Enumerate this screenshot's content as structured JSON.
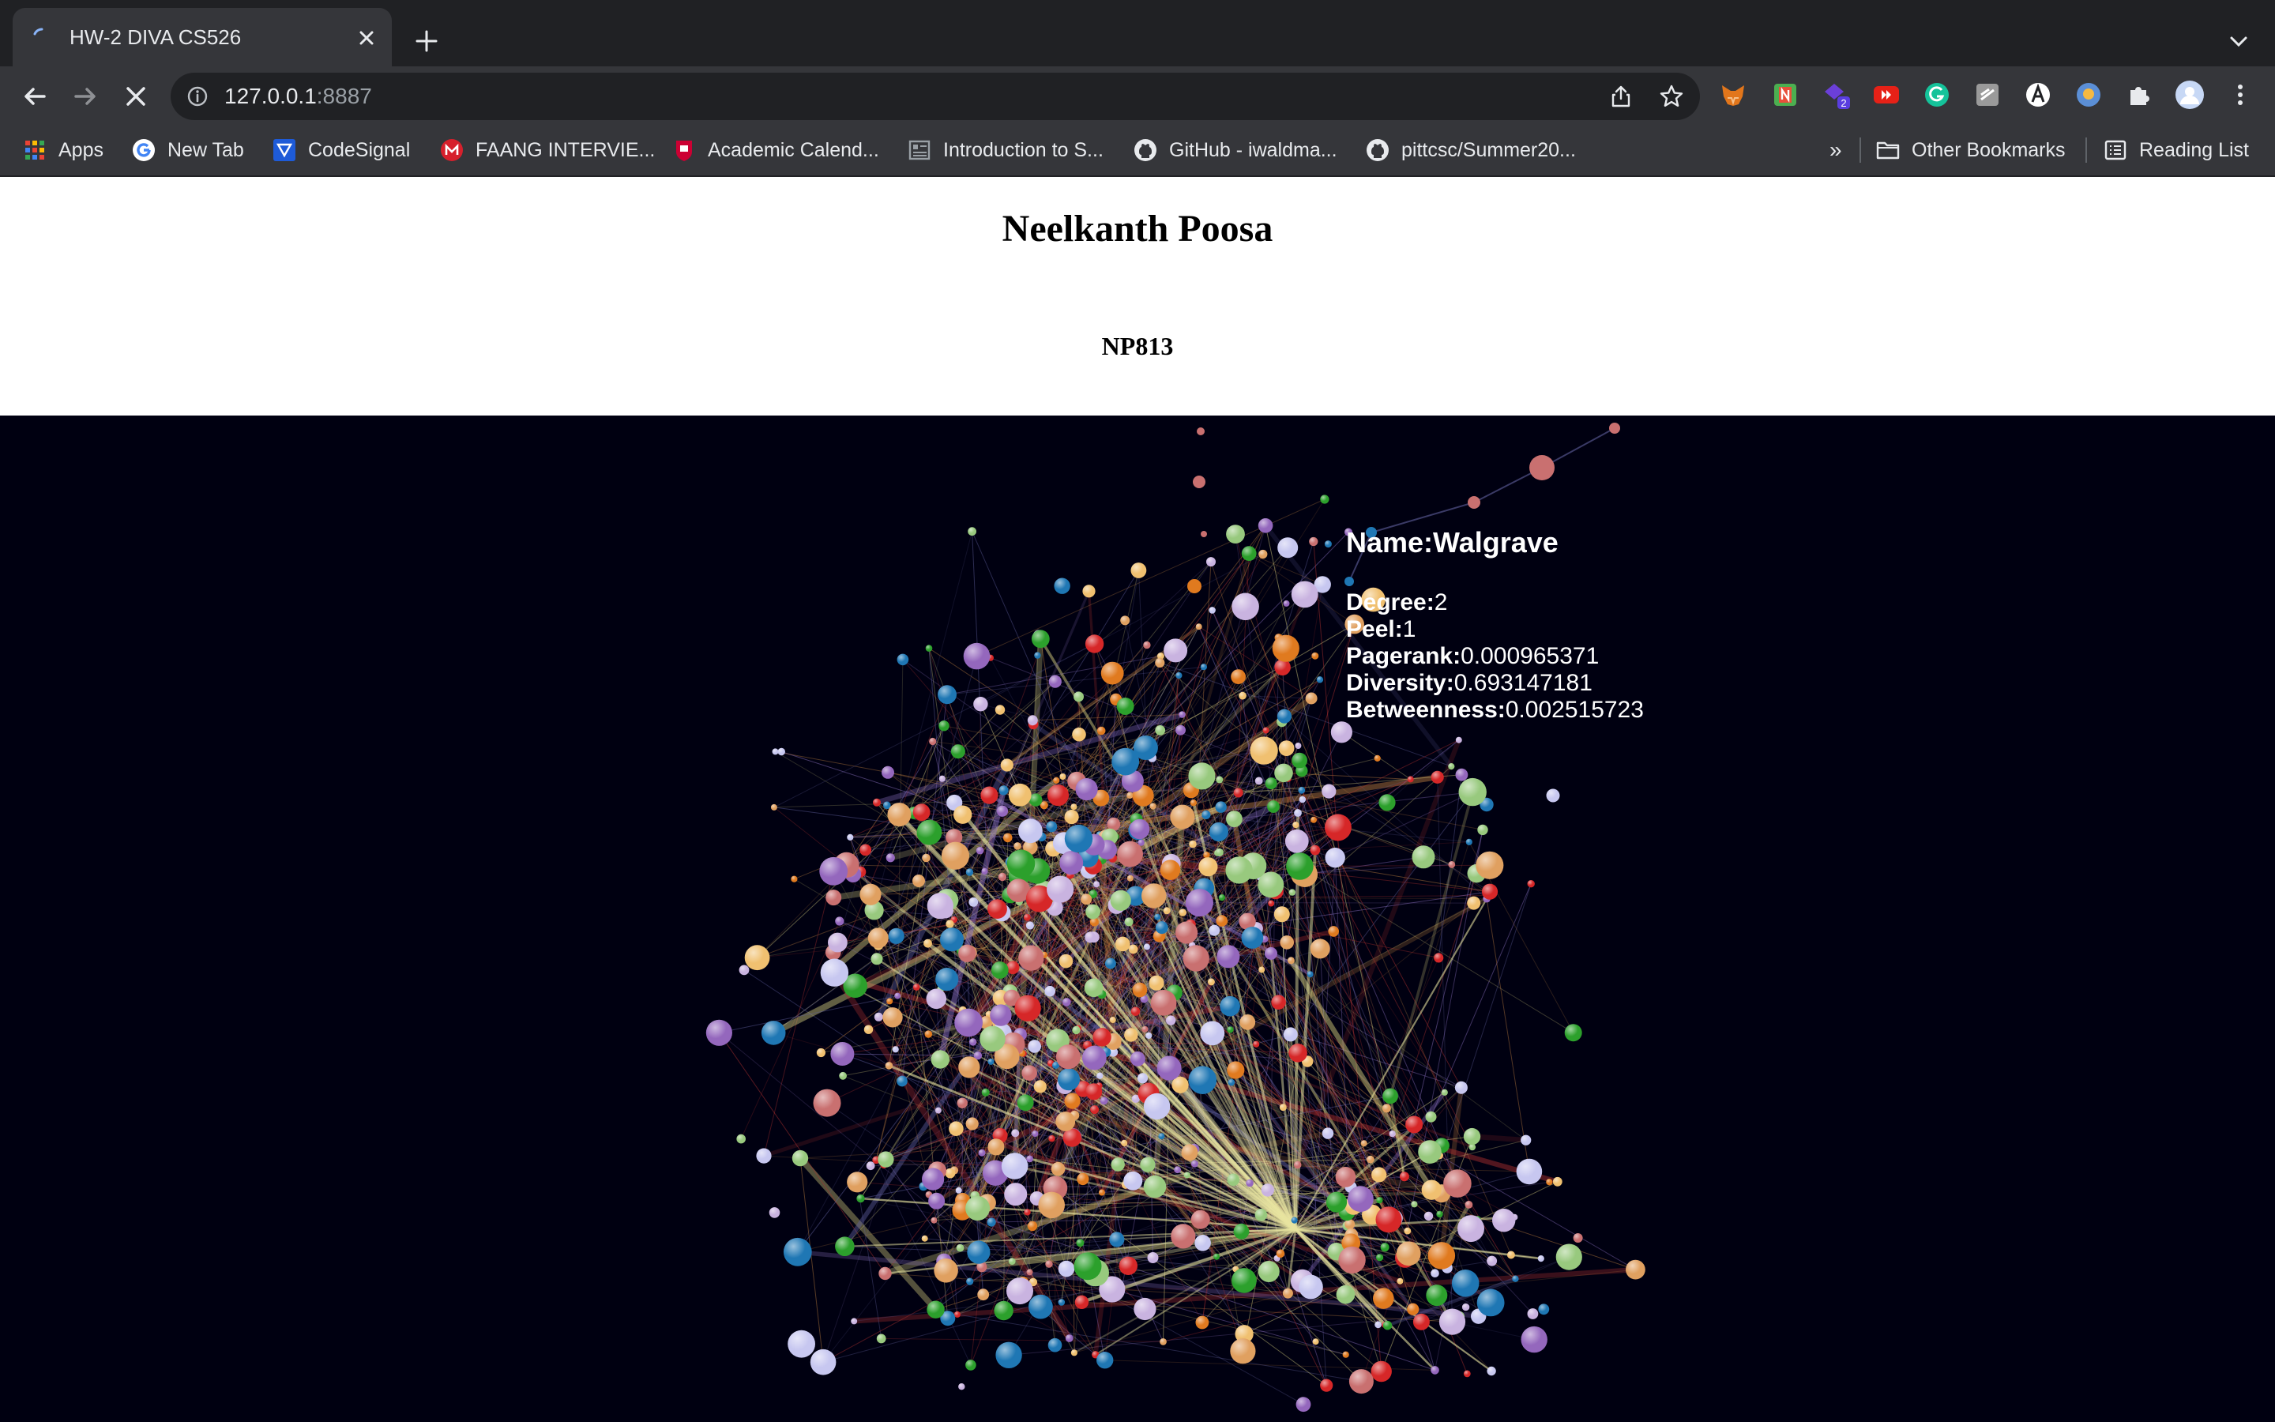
{
  "browser": {
    "tab_title": "HW-2 DIVA CS526",
    "url_host": "127.0.0.1",
    "url_port": ":8887",
    "extension_badge": "2",
    "bookmarks": [
      {
        "label": "Apps",
        "icon": "apps-grid-icon"
      },
      {
        "label": "New Tab",
        "icon": "google-icon"
      },
      {
        "label": "CodeSignal",
        "icon": "codesignal-icon"
      },
      {
        "label": "FAANG INTERVIE...",
        "icon": "m-logo-icon"
      },
      {
        "label": "Academic Calend...",
        "icon": "university-icon"
      },
      {
        "label": "Introduction to S...",
        "icon": "page-icon"
      },
      {
        "label": "GitHub - iwaldma...",
        "icon": "github-icon"
      },
      {
        "label": "pittcsc/Summer20...",
        "icon": "github-icon"
      }
    ],
    "overflow_label": "»",
    "other_bookmarks": "Other Bookmarks",
    "reading_list": "Reading List"
  },
  "page": {
    "title": "Neelkanth Poosa",
    "subtitle": "NP813"
  },
  "tooltip": {
    "name_label": "Name:",
    "name_value": "Walgrave",
    "rows": [
      {
        "label": "Degree:",
        "value": "2"
      },
      {
        "label": "Peel:",
        "value": "1"
      },
      {
        "label": "Pagerank:",
        "value": "0.000965371"
      },
      {
        "label": "Diversity:",
        "value": "0.693147181"
      },
      {
        "label": "Betweenness:",
        "value": "0.002515723"
      }
    ]
  },
  "graph": {
    "node_colors": [
      "#c9b3e0",
      "#e07a1f",
      "#1f77b4",
      "#d62728",
      "#98c97e",
      "#2ca02c",
      "#f0c070",
      "#9467bd",
      "#c97070",
      "#c7c7f0",
      "#e0a060"
    ],
    "edge_colors": [
      "#d8d080",
      "#8a6fc0",
      "#b03030",
      "#6060a0",
      "#c08040"
    ],
    "hub_edge_color": "#e8e4a0"
  }
}
